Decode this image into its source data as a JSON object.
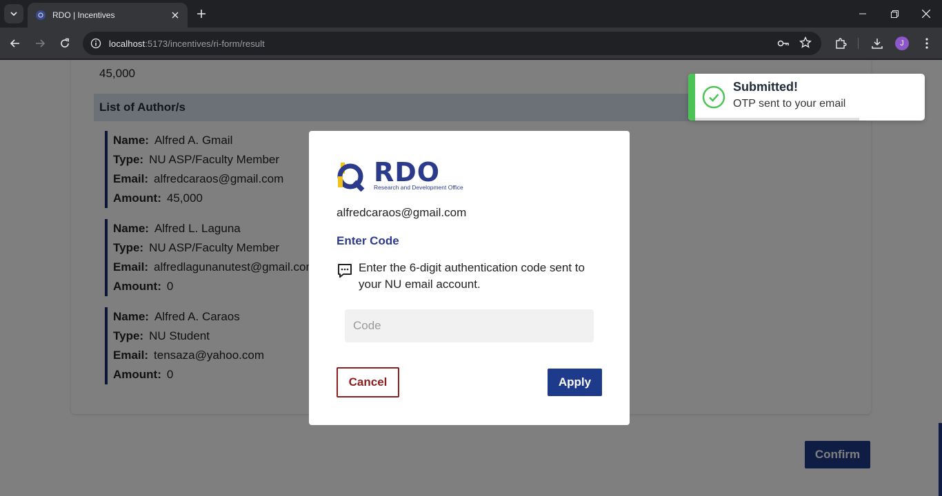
{
  "browser": {
    "tab_title": "RDO | Incentives",
    "url_host": "localhost",
    "url_path": ":5173/incentives/ri-form/result",
    "profile_initial": "J"
  },
  "page": {
    "amount_top": "45,000",
    "authors_header": "List of Author/s",
    "authors": [
      {
        "name_label": "Name:",
        "name": "Alfred A. Gmail",
        "type_label": "Type:",
        "type": "NU ASP/Faculty Member",
        "email_label": "Email:",
        "email": "alfredcaraos@gmail.com",
        "amount_label": "Amount:",
        "amount": "45,000"
      },
      {
        "name_label": "Name:",
        "name": "Alfred L. Laguna",
        "type_label": "Type:",
        "type": "NU ASP/Faculty Member",
        "email_label": "Email:",
        "email": "alfredlagunanutest@gmail.com",
        "amount_label": "Amount:",
        "amount": "0"
      },
      {
        "name_label": "Name:",
        "name": "Alfred A. Caraos",
        "type_label": "Type:",
        "type": "NU Student",
        "email_label": "Email:",
        "email": "tensaza@yahoo.com",
        "amount_label": "Amount:",
        "amount": "0"
      }
    ],
    "confirm_label": "Confirm"
  },
  "modal": {
    "logo_text": "RDO",
    "logo_subtitle": "Research and Development Office",
    "email": "alfredcaraos@gmail.com",
    "heading": "Enter Code",
    "message": "Enter the 6-digit authentication code sent to your NU email account.",
    "code_placeholder": "Code",
    "code_value": "",
    "cancel_label": "Cancel",
    "apply_label": "Apply"
  },
  "toast": {
    "title": "Submitted!",
    "message": "OTP sent to your email"
  },
  "colors": {
    "primary": "#1e3a8a",
    "cancel": "#8b1e1e",
    "success": "#4cc455",
    "header_bg": "#d8e1ef"
  }
}
